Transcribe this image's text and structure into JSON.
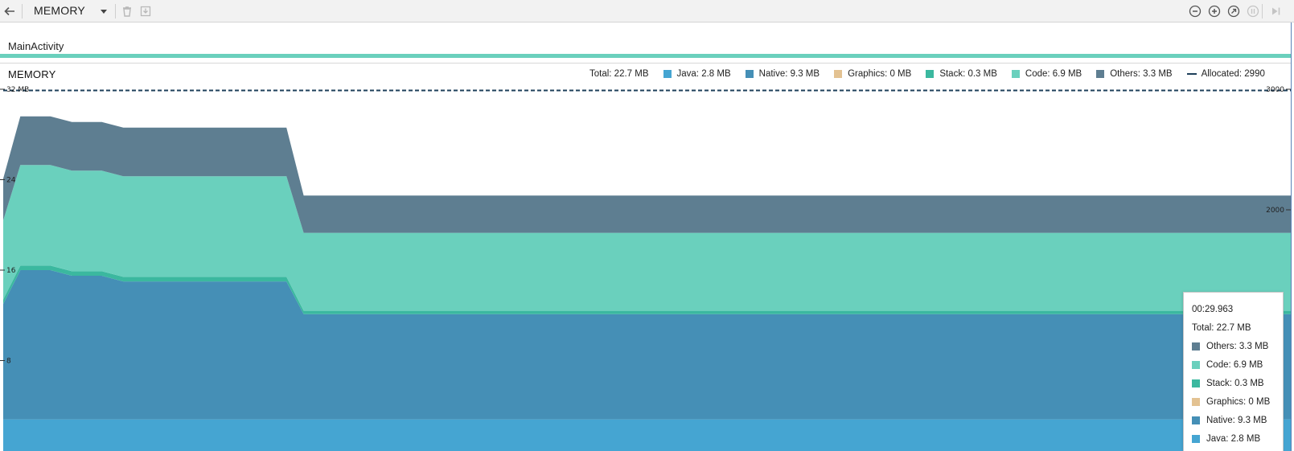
{
  "toolbar": {
    "title": "MEMORY",
    "icons": [
      "back-arrow-icon",
      "dropdown-caret-icon",
      "trash-icon",
      "download-icon",
      "zoom-out-icon",
      "zoom-in-icon",
      "reset-zoom-icon",
      "pause-icon",
      "go-live-icon"
    ]
  },
  "activity": {
    "label": "MainActivity",
    "color": "#6ad0bd"
  },
  "chart_header": {
    "title": "MEMORY",
    "total": "Total: 22.7 MB",
    "legend": [
      {
        "label": "Java: 2.8 MB",
        "color": "#45a5d2"
      },
      {
        "label": "Native: 9.3 MB",
        "color": "#458fb6"
      },
      {
        "label": "Graphics: 0 MB",
        "color": "#e3c292"
      },
      {
        "label": "Stack: 0.3 MB",
        "color": "#3bb89f"
      },
      {
        "label": "Code: 6.9 MB",
        "color": "#6ad0bd"
      },
      {
        "label": "Others: 3.3 MB",
        "color": "#5e7e91"
      }
    ],
    "allocated": "Allocated: 2990"
  },
  "chart_data": {
    "type": "area",
    "stacked": true,
    "y_unit": "MB",
    "y_ticks": [
      "32 MB",
      "24",
      "16",
      "8"
    ],
    "y_tick_values": [
      32,
      24,
      16,
      8
    ],
    "ylim": [
      0,
      32
    ],
    "right_axis": {
      "ticks": [
        "3000",
        "2000"
      ],
      "tick_values": [
        3000,
        2000
      ],
      "ylim": [
        0,
        3000
      ]
    },
    "x": [
      0,
      0.4,
      1.1,
      1.6,
      2.3,
      2.8,
      6.6,
      7.0,
      30
    ],
    "series": [
      {
        "name": "Java",
        "color": "#45a5d2",
        "values": [
          2.8,
          2.8,
          2.8,
          2.8,
          2.8,
          2.8,
          2.8,
          2.8,
          2.8
        ]
      },
      {
        "name": "Native",
        "color": "#458fb6",
        "values": [
          10.2,
          13.2,
          13.2,
          12.7,
          12.7,
          12.2,
          12.2,
          9.3,
          9.3
        ]
      },
      {
        "name": "Graphics",
        "color": "#e3c292",
        "values": [
          0,
          0,
          0,
          0,
          0,
          0,
          0,
          0,
          0
        ]
      },
      {
        "name": "Stack",
        "color": "#3bb89f",
        "values": [
          0.4,
          0.4,
          0.4,
          0.4,
          0.4,
          0.4,
          0.4,
          0.3,
          0.3
        ]
      },
      {
        "name": "Code",
        "color": "#6ad0bd",
        "values": [
          7.0,
          8.9,
          8.9,
          8.9,
          8.9,
          8.9,
          8.9,
          6.9,
          6.9
        ]
      },
      {
        "name": "Others",
        "color": "#5e7e91",
        "values": [
          3.7,
          4.3,
          4.3,
          4.3,
          4.3,
          4.3,
          4.3,
          3.3,
          3.3
        ]
      }
    ],
    "allocated": {
      "name": "Allocated",
      "color": "#1e3f5a",
      "values": [
        2990,
        2990,
        2990,
        2990,
        2990,
        2990,
        2990,
        2990,
        2990
      ]
    }
  },
  "tooltip": {
    "time": "00:29.963",
    "total": "Total: 22.7 MB",
    "rows": [
      {
        "label": "Others: 3.3 MB",
        "color": "#5e7e91"
      },
      {
        "label": "Code: 6.9 MB",
        "color": "#6ad0bd"
      },
      {
        "label": "Stack: 0.3 MB",
        "color": "#3bb89f"
      },
      {
        "label": "Graphics: 0 MB",
        "color": "#e3c292"
      },
      {
        "label": "Native: 9.3 MB",
        "color": "#458fb6"
      },
      {
        "label": "Java: 2.8 MB",
        "color": "#45a5d2"
      }
    ]
  }
}
